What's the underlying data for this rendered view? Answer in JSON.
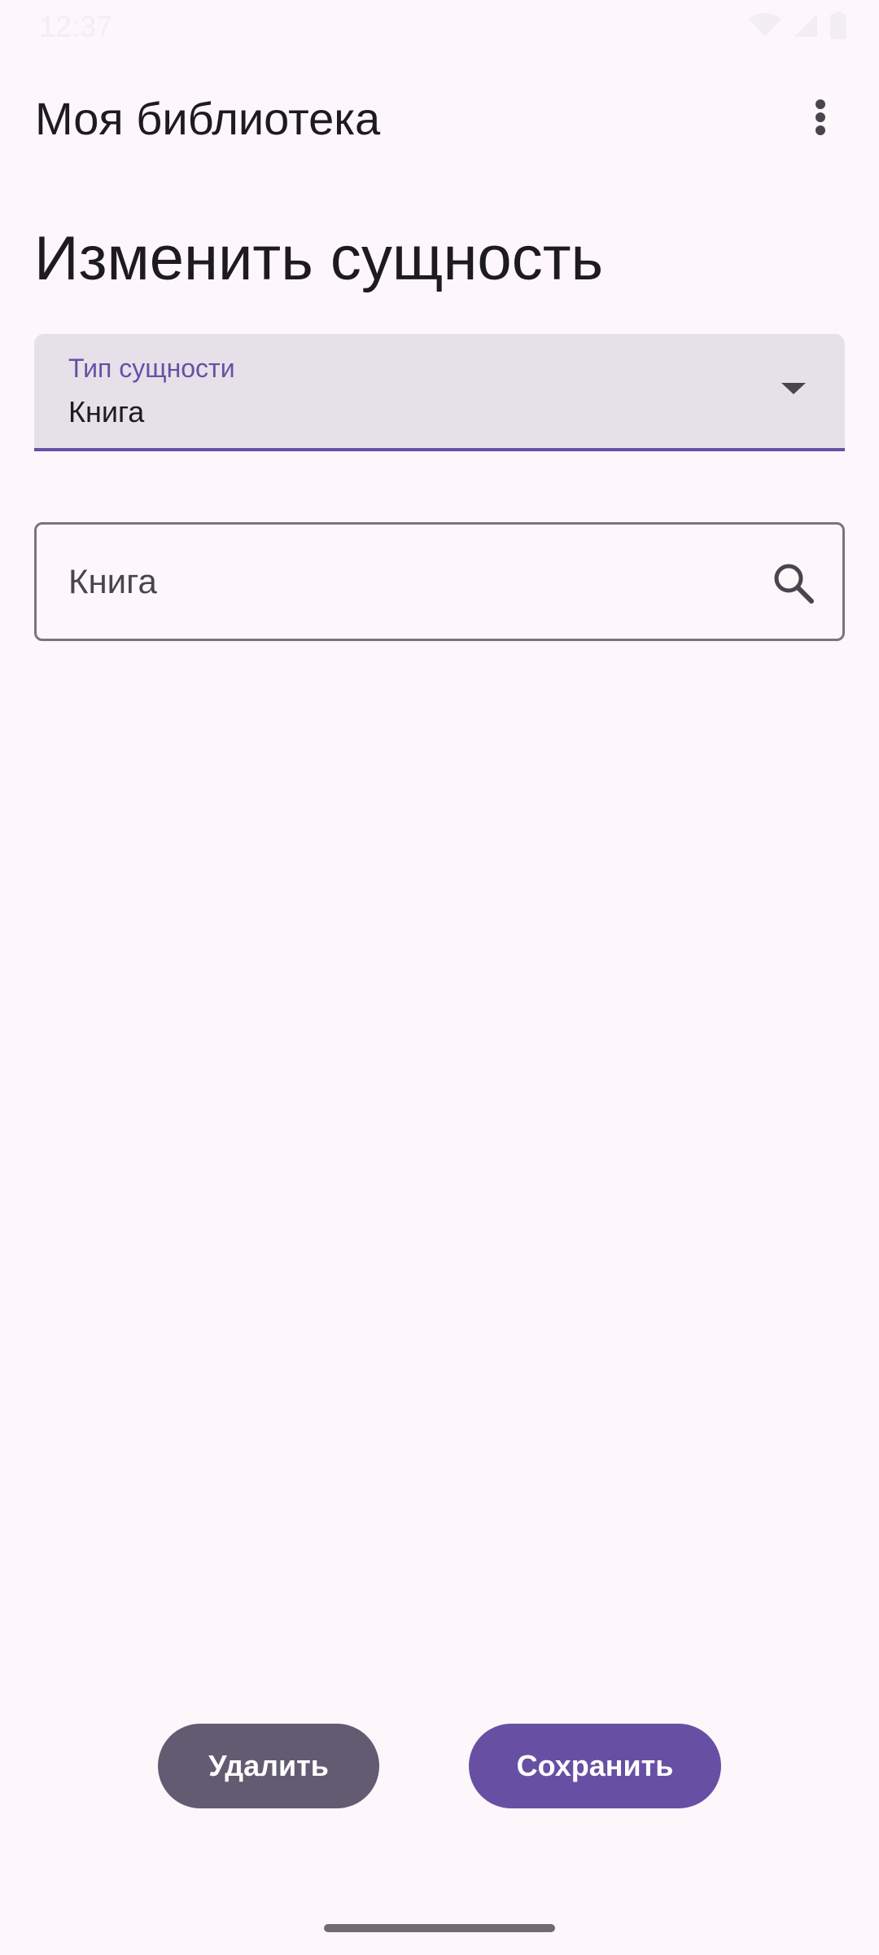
{
  "status_bar": {
    "time": "12:37",
    "icons": [
      "wifi-icon",
      "signal-icon",
      "battery-icon"
    ]
  },
  "app_bar": {
    "title": "Моя библиотека",
    "menu_icon": "more-vert-icon"
  },
  "page": {
    "title": "Изменить сущность"
  },
  "entity_type": {
    "label": "Тип сущности",
    "value": "Книга",
    "icon": "arrow-drop-down-icon"
  },
  "search": {
    "placeholder": "Книга",
    "icon": "search-icon"
  },
  "actions": {
    "delete_label": "Удалить",
    "save_label": "Сохранить"
  },
  "colors": {
    "background": "#FDF7FC",
    "primary": "#6750A4",
    "secondary": "#625B71",
    "field_fill": "#E6E0E9",
    "outline": "#79747E"
  }
}
